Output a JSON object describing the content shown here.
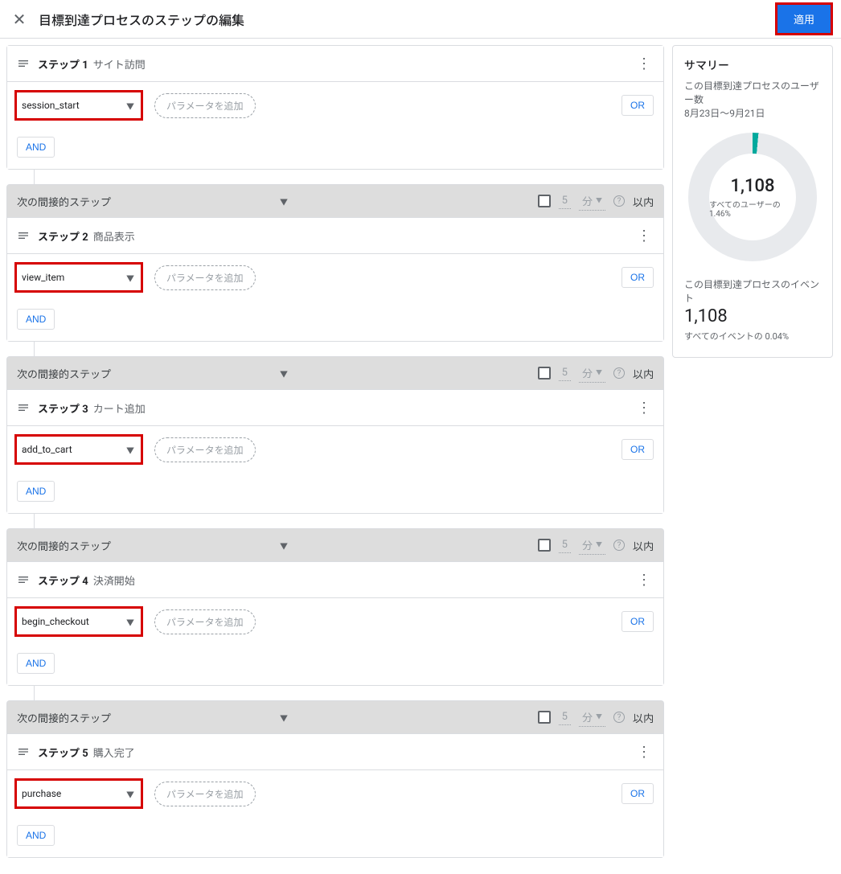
{
  "header": {
    "title": "目標到達プロセスのステップの編集",
    "apply": "適用"
  },
  "labels": {
    "param_chip": "パラメータを追加",
    "or": "OR",
    "and": "AND",
    "indirect": "次の間接的ステップ",
    "time_num": "5",
    "time_unit": "分",
    "within": "以内"
  },
  "steps": [
    {
      "index": "ステップ 1",
      "name": "サイト訪問",
      "event": "session_start"
    },
    {
      "index": "ステップ 2",
      "name": "商品表示",
      "event": "view_item"
    },
    {
      "index": "ステップ 3",
      "name": "カート追加",
      "event": "add_to_cart"
    },
    {
      "index": "ステップ 4",
      "name": "決済開始",
      "event": "begin_checkout"
    },
    {
      "index": "ステップ 5",
      "name": "購入完了",
      "event": "purchase"
    }
  ],
  "summary": {
    "title": "サマリー",
    "users_label": "この目標到達プロセスのユーザー数",
    "date_range": "8月23日～9月21日",
    "users_value": "1,108",
    "users_pct": "すべてのユーザーの 1.46%",
    "events_label": "この目標到達プロセスのイベント",
    "events_value": "1,108",
    "events_pct": "すべてのイベントの 0.04%"
  }
}
